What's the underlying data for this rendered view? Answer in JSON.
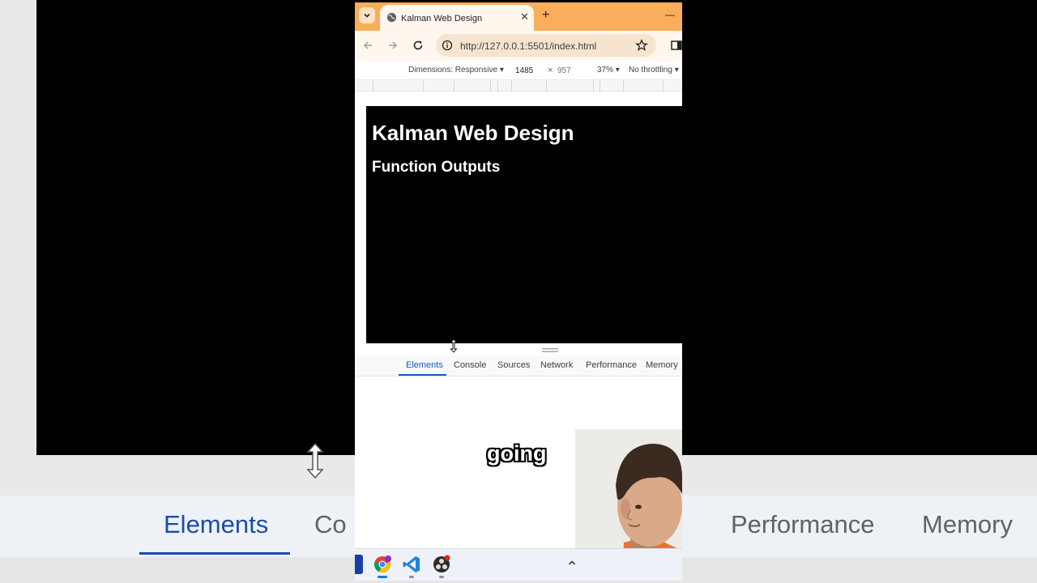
{
  "browser": {
    "tab_title": "Kalman Web Design",
    "tab_close": "✕",
    "new_tab": "+",
    "minimize": "—",
    "url": "http://127.0.0.1:5501/index.html",
    "accent_color": "#f8ae5b"
  },
  "device_toolbar": {
    "dimensions": "Dimensions: Responsive",
    "width": "1485",
    "times": "×",
    "height_placeholder": "957",
    "zoom": "37%",
    "throttling": "No throttling"
  },
  "page": {
    "heading": "Kalman Web Design",
    "subheading": "Function Outputs",
    "background_color": "#000000"
  },
  "devtools": {
    "tabs": [
      "Elements",
      "Console",
      "Sources",
      "Network",
      "Performance",
      "Memory"
    ],
    "active_tab": "Elements"
  },
  "background_zoom": {
    "tabs": [
      "Elements",
      "Co",
      "Performance",
      "Memory"
    ]
  },
  "caption": {
    "word": "going"
  },
  "taskbar": {
    "apps": [
      "chrome-icon",
      "vscode-icon",
      "obs-icon"
    ]
  }
}
